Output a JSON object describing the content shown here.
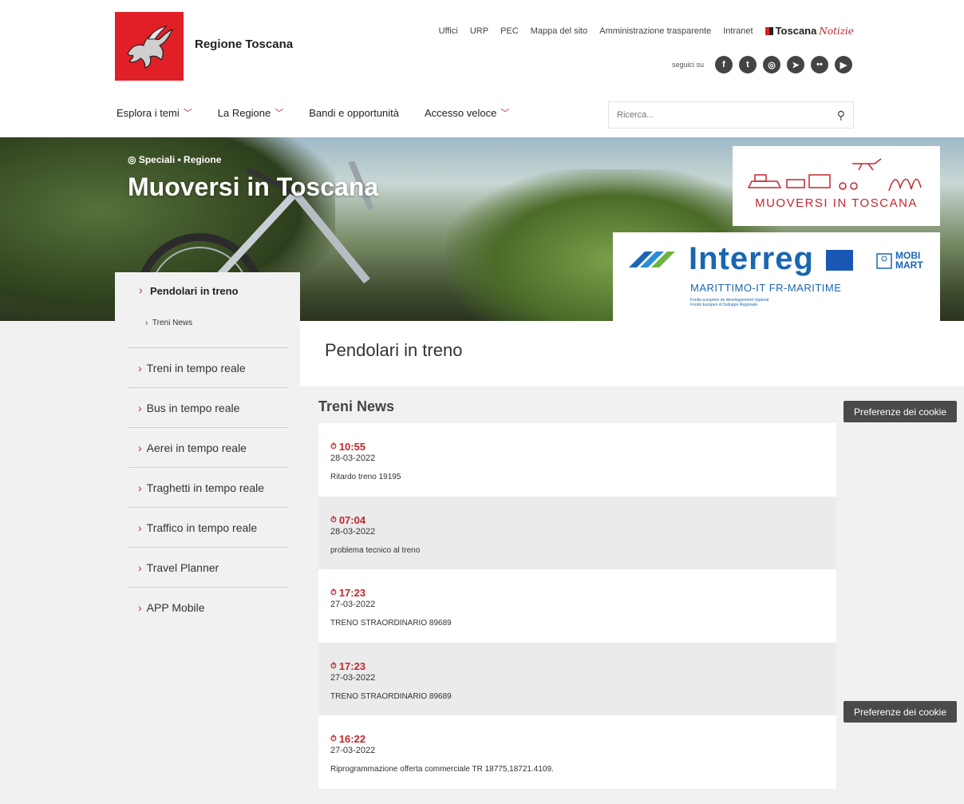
{
  "header": {
    "brand": "Regione Toscana",
    "top_links": [
      "Uffici",
      "URP",
      "PEC",
      "Mappa del sito",
      "Amministrazione trasparente",
      "Intranet"
    ],
    "toscana_notizie": {
      "bold": "Toscana",
      "italic": "Notizie"
    },
    "social_label": "seguici su",
    "social_icons": [
      "facebook-icon",
      "twitter-icon",
      "instagram-icon",
      "telegram-icon",
      "flickr-icon",
      "youtube-icon"
    ],
    "nav": [
      {
        "label": "Esplora i temi",
        "dropdown": true
      },
      {
        "label": "La Regione",
        "dropdown": true
      },
      {
        "label": "Bandi e opportunità",
        "dropdown": false
      },
      {
        "label": "Accesso veloce",
        "dropdown": true
      }
    ],
    "search_placeholder": "Ricerca..."
  },
  "hero": {
    "crumb": "Speciali • Regione",
    "title": "Muoversi in Toscana",
    "banner1_text": "MUOVERSI IN TOSCANA",
    "banner2": {
      "interreg": "Interreg",
      "maritimo": "MARITTIMO-IT FR-MARITIME",
      "fonds_line1": "Fonds européen de développement régional",
      "fonds_line2": "Fondo Europeo di Sviluppo Regionale",
      "mobimart_line1": "MOBI",
      "mobimart_line2": "MART"
    }
  },
  "sidebar": {
    "active": "Pendolari in treno",
    "sub": "Treni News",
    "items": [
      "Treni in tempo reale",
      "Bus in tempo reale",
      "Aerei in tempo reale",
      "Traghetti in tempo reale",
      "Traffico in tempo reale",
      "Travel Planner",
      "APP Mobile"
    ]
  },
  "main": {
    "page_title": "Pendolari in treno",
    "section_title": "Treni News",
    "news": [
      {
        "time": "10:55",
        "date": "28-03-2022",
        "text": "Ritardo treno 19195"
      },
      {
        "time": "07:04",
        "date": "28-03-2022",
        "text": "problema tecnico al treno"
      },
      {
        "time": "17:23",
        "date": "27-03-2022",
        "text": "TRENO STRAORDINARIO 89689"
      },
      {
        "time": "17:23",
        "date": "27-03-2022",
        "text": "TRENO STRAORDINARIO 89689"
      },
      {
        "time": "16:22",
        "date": "27-03-2022",
        "text": "Riprogrammazione offerta commerciale TR 18775,18721.4109."
      }
    ]
  },
  "cookie_button": "Preferenze dei cookie",
  "colors": {
    "brand_red": "#e11f26",
    "accent_red": "#c1272d",
    "interreg_blue": "#1a66b3"
  }
}
